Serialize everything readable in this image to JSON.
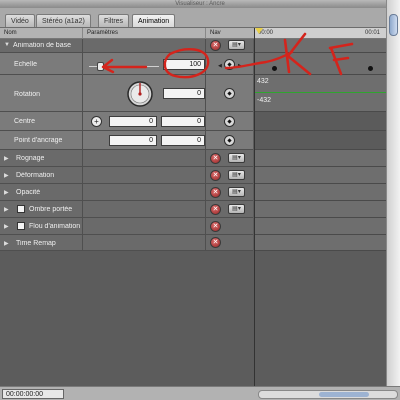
{
  "window": {
    "title": "Visualiseur : Ancre"
  },
  "tabs": [
    {
      "label": "Vidéo"
    },
    {
      "label": "Stéréo (a1a2)"
    },
    {
      "label": "Filtres"
    },
    {
      "label": "Animation"
    }
  ],
  "columns": {
    "name": "Nom",
    "params": "Paramètres",
    "nav": "Nav"
  },
  "ruler": {
    "start": "00:00",
    "end": "00:01"
  },
  "sections": {
    "basic_motion": {
      "label": "Animation de base"
    },
    "scale": {
      "label": "Échelle",
      "value": "100"
    },
    "rotation": {
      "label": "Rotation",
      "value": "0",
      "track_max": "432",
      "track_min": "-432"
    },
    "center": {
      "label": "Centre",
      "x": "0",
      "y": "0"
    },
    "anchor": {
      "label": "Point d'ancrage",
      "x": "0",
      "y": "0"
    },
    "crop": {
      "label": "Rognage"
    },
    "distort": {
      "label": "Déformation"
    },
    "opacity": {
      "label": "Opacité"
    },
    "drop_shadow": {
      "label": "Ombre portée"
    },
    "motion_blur": {
      "label": "Flou d'animation"
    },
    "time_remap": {
      "label": "Time Remap"
    }
  },
  "status": {
    "timecode": "00:00:00:00"
  },
  "icons": {
    "reset": "x-icon",
    "menu": "menu-icon",
    "keyframe": "keyframe-icon",
    "crosshair": "crosshair-icon",
    "dial": "rotation-dial-icon"
  },
  "colors": {
    "annotation": "#d4241c",
    "track_line": "#2fa52f",
    "window_bg": "#6f6f6f"
  }
}
